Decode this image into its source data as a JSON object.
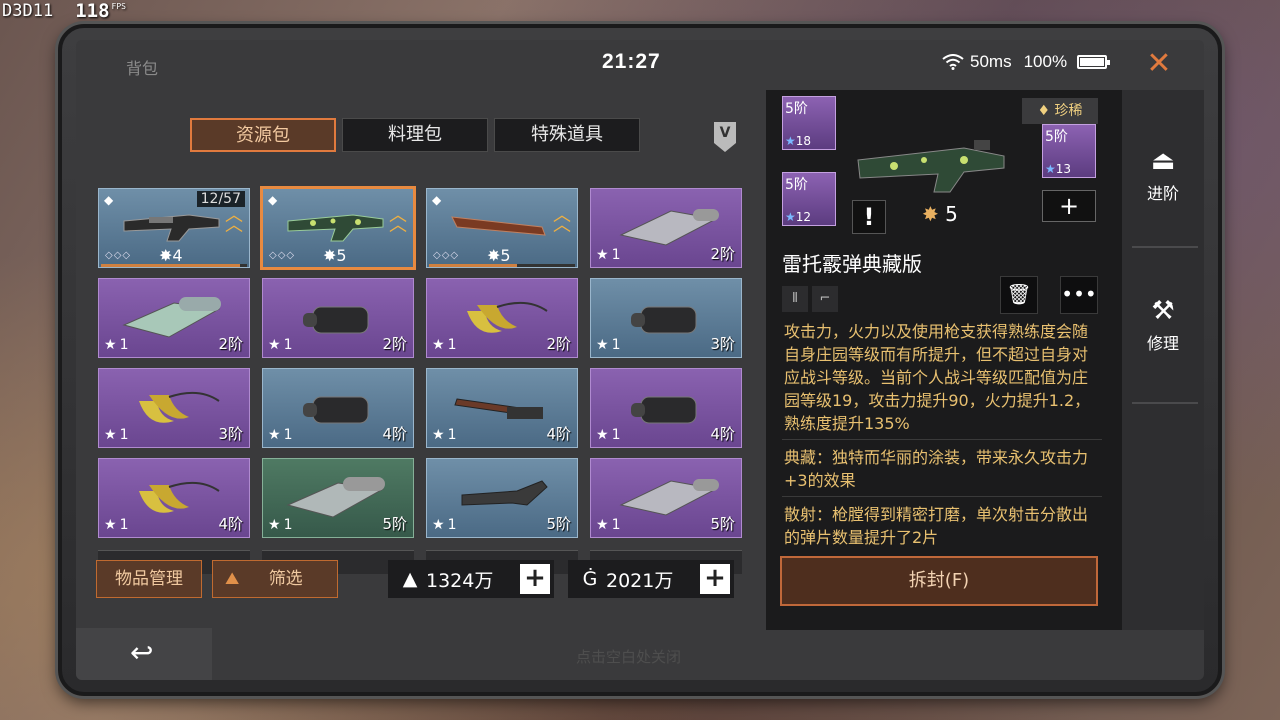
{
  "overlay": {
    "fps_tag": "D3D11",
    "fps_value": "118",
    "fps_unit": "FPS"
  },
  "header": {
    "title": "背包",
    "time": "21:27",
    "ping": "50ms",
    "battery": "100%",
    "close_icon": "close-icon"
  },
  "tabs": [
    {
      "label": "资源包",
      "active": true
    },
    {
      "label": "料理包",
      "active": false
    },
    {
      "label": "特殊道具",
      "active": false
    }
  ],
  "grid": [
    {
      "kind": "weapon",
      "rarity": "blue",
      "count": "12/57",
      "level": "4",
      "selected": false
    },
    {
      "kind": "weapon",
      "rarity": "blue",
      "level": "5",
      "selected": true
    },
    {
      "kind": "weapon",
      "rarity": "blue",
      "level": "5",
      "selected": false
    },
    {
      "kind": "mod",
      "rarity": "purple",
      "stars": "1",
      "tier": "2阶"
    },
    {
      "kind": "mod",
      "rarity": "purple",
      "stars": "1",
      "tier": "2阶"
    },
    {
      "kind": "mod",
      "rarity": "purple",
      "stars": "1",
      "tier": "2阶"
    },
    {
      "kind": "mod",
      "rarity": "purple",
      "stars": "1",
      "tier": "2阶"
    },
    {
      "kind": "mod",
      "rarity": "blue",
      "stars": "1",
      "tier": "3阶"
    },
    {
      "kind": "mod",
      "rarity": "purple",
      "stars": "1",
      "tier": "3阶"
    },
    {
      "kind": "mod",
      "rarity": "blue",
      "stars": "1",
      "tier": "4阶"
    },
    {
      "kind": "mod",
      "rarity": "blue",
      "stars": "1",
      "tier": "4阶"
    },
    {
      "kind": "mod",
      "rarity": "purple",
      "stars": "1",
      "tier": "4阶"
    },
    {
      "kind": "mod",
      "rarity": "purple",
      "stars": "1",
      "tier": "4阶"
    },
    {
      "kind": "mod",
      "rarity": "green",
      "stars": "1",
      "tier": "5阶"
    },
    {
      "kind": "mod",
      "rarity": "blue",
      "stars": "1",
      "tier": "5阶"
    },
    {
      "kind": "mod",
      "rarity": "purple",
      "stars": "1",
      "tier": "5阶"
    }
  ],
  "bottom": {
    "manage_label": "物品管理",
    "filter_label": "筛选",
    "currency1": "1324万",
    "currency2": "2021万",
    "hint": "点击空白处关闭"
  },
  "detail": {
    "rarity_label": "珍稀",
    "mods": [
      {
        "tier": "5阶",
        "stars": "18"
      },
      {
        "tier": "5阶",
        "stars": "12"
      },
      {
        "tier": "5阶",
        "stars": "13"
      }
    ],
    "weapon_level": "5",
    "weapon_name": "雷托霰弹典藏版",
    "desc": [
      "攻击力，火力以及使用枪支获得熟练度会随自身庄园等级而有所提升，但不超过自身对应战斗等级。当前个人战斗等级匹配值为庄园等级19，攻击力提升90，火力提升1.2，熟练度提升135%",
      "典藏：独特而华丽的涂装，带来永久攻击力+3的效果",
      "散射：枪膛得到精密打磨，单次射击分散出的弹片数量提升了2片"
    ],
    "unseal_label": "拆封(F)"
  },
  "side_menu": [
    {
      "label": "进阶",
      "icon": "upgrade-icon"
    },
    {
      "label": "修理",
      "icon": "repair-icon"
    }
  ],
  "colors": {
    "accent": "#e07a3e",
    "blue_rarity": "#5a7a96",
    "purple_rarity": "#7a52a0",
    "green_rarity": "#45695a",
    "desc_text": "#e8c070"
  }
}
